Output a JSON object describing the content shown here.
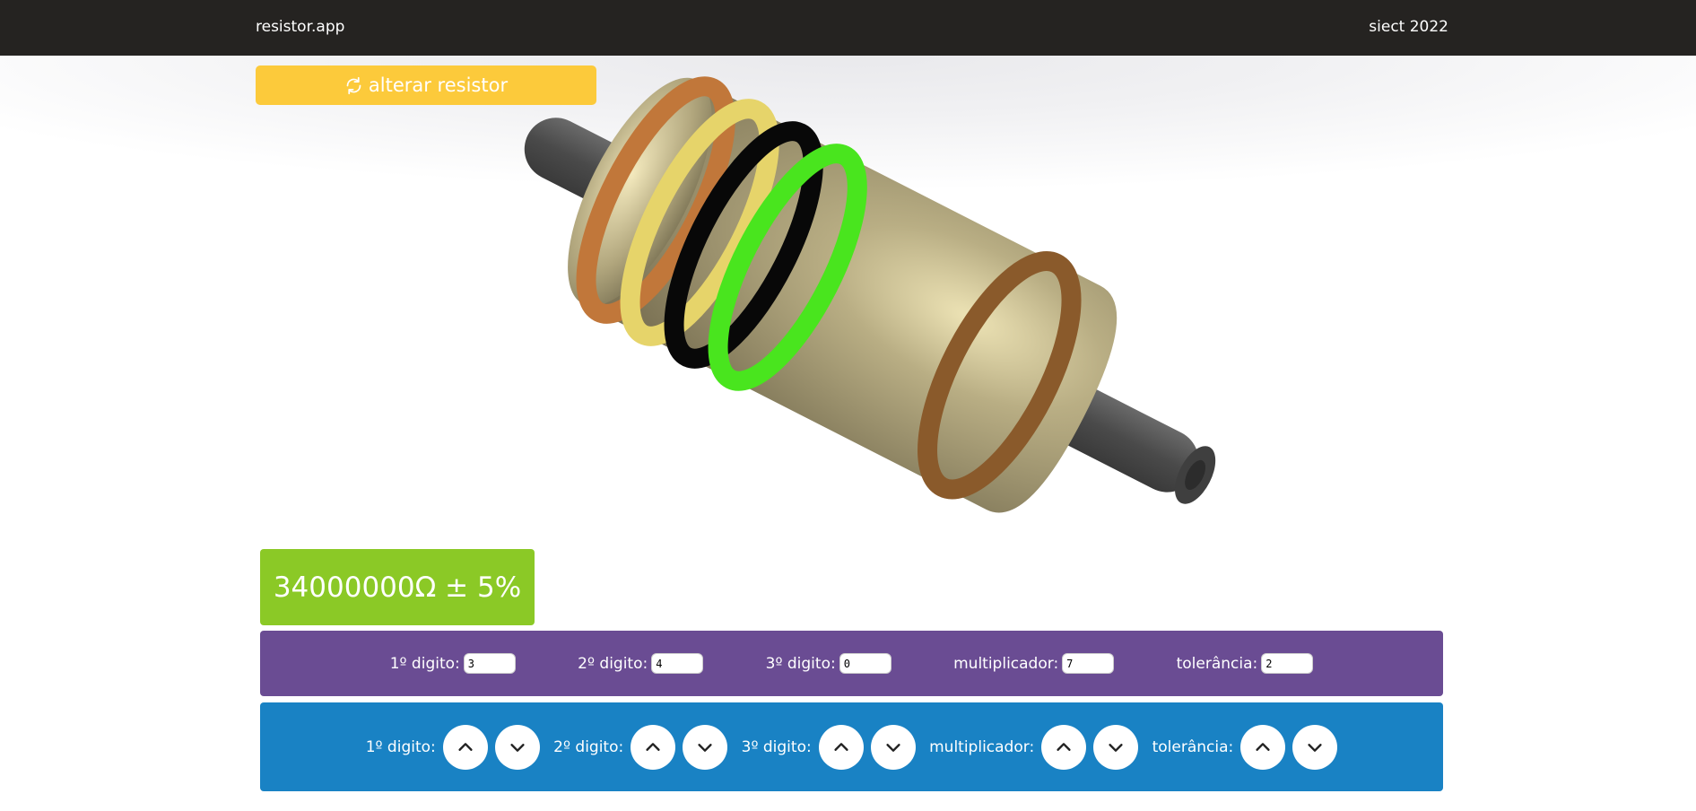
{
  "header": {
    "brand": "resistor.app",
    "event": "siect 2022"
  },
  "toolbar": {
    "change_label": "alterar resistor"
  },
  "resistor": {
    "bands": [
      {
        "name": "1st digit",
        "color": "#c1773a"
      },
      {
        "name": "2nd digit",
        "color": "#e6d46a"
      },
      {
        "name": "3rd digit",
        "color": "#080808"
      },
      {
        "name": "multiplier",
        "color": "#49e51e"
      },
      {
        "name": "tolerance",
        "color": "#8a5a2b"
      }
    ],
    "body_color": "#b7ad83",
    "lead_color": "#555555"
  },
  "result": {
    "text": "34000000Ω ± 5%"
  },
  "inputs": {
    "fields": [
      {
        "label": "1º digito:",
        "value": "3"
      },
      {
        "label": "2º digito:",
        "value": "4"
      },
      {
        "label": "3º digito:",
        "value": "0"
      },
      {
        "label": "multiplicador:",
        "value": "7"
      },
      {
        "label": "tolerância:",
        "value": "2"
      }
    ]
  },
  "steppers": {
    "items": [
      {
        "label": "1º digito:"
      },
      {
        "label": "2º digito:"
      },
      {
        "label": "3º digito:"
      },
      {
        "label": "multiplicador:"
      },
      {
        "label": "tolerância:"
      }
    ],
    "up_icon": "chevron-up-icon",
    "down_icon": "chevron-down-icon"
  },
  "colors": {
    "header_bg": "#252321",
    "button_bg": "#fcca3b",
    "result_bg": "#8bc926",
    "inputs_bg": "#6a4c93",
    "steppers_bg": "#1982c4"
  }
}
